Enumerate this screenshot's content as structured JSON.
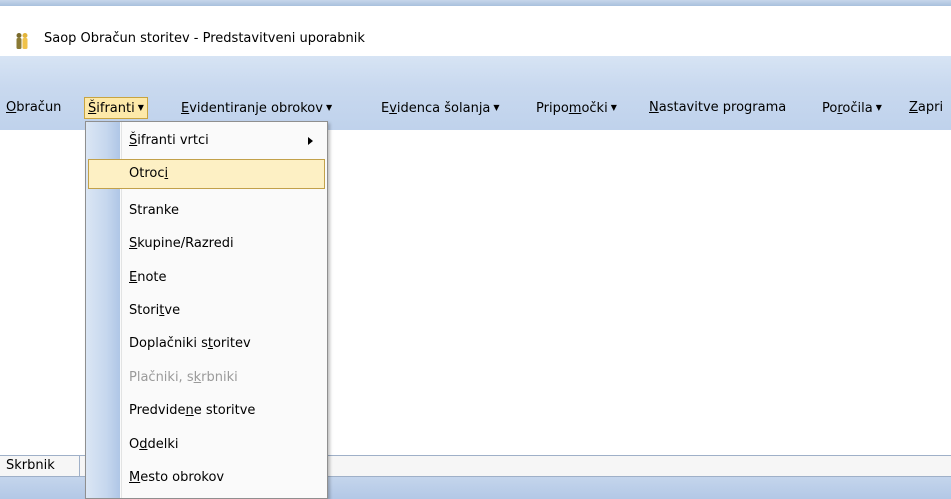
{
  "window": {
    "title": "Saop Obračun storitev - Predstavitveni uporabnik",
    "icon": "app-people-icon"
  },
  "menubar": {
    "items": [
      {
        "pre": "",
        "mn": "O",
        "post": "bračun",
        "dropdown": false
      },
      {
        "pre": "",
        "mn": "Š",
        "post": "ifranti",
        "dropdown": true
      },
      {
        "pre": "",
        "mn": "E",
        "post": "videntiranje obrokov",
        "dropdown": true
      },
      {
        "pre": "E",
        "mn": "v",
        "post": "idenca šolanja",
        "dropdown": true
      },
      {
        "pre": "Pripo",
        "mn": "m",
        "post": "očki",
        "dropdown": true
      },
      {
        "pre": "",
        "mn": "N",
        "post": "astavitve programa",
        "dropdown": false
      },
      {
        "pre": "Po",
        "mn": "r",
        "post": "očila",
        "dropdown": true
      },
      {
        "pre": "",
        "mn": "Z",
        "post": "apri",
        "dropdown": false
      }
    ]
  },
  "sifranti_menu": {
    "items": [
      {
        "pre": "",
        "mn": "Š",
        "post": "ifranti vrtci",
        "submenu": true,
        "enabled": true,
        "highlighted": false
      },
      {
        "pre": "Otroc",
        "mn": "i",
        "post": "",
        "submenu": false,
        "enabled": true,
        "highlighted": true
      },
      {
        "pre": "Stranke",
        "mn": "",
        "post": "",
        "submenu": false,
        "enabled": true,
        "highlighted": false
      },
      {
        "pre": "",
        "mn": "S",
        "post": "kupine/Razredi",
        "submenu": false,
        "enabled": true,
        "highlighted": false
      },
      {
        "pre": "",
        "mn": "E",
        "post": "note",
        "submenu": false,
        "enabled": true,
        "highlighted": false
      },
      {
        "pre": "Stori",
        "mn": "t",
        "post": "ve",
        "submenu": false,
        "enabled": true,
        "highlighted": false
      },
      {
        "pre": "Doplačniki s",
        "mn": "t",
        "post": "oritev",
        "submenu": false,
        "enabled": true,
        "highlighted": false
      },
      {
        "pre": "Plačniki, s",
        "mn": "k",
        "post": "rbniki",
        "submenu": false,
        "enabled": false,
        "highlighted": false
      },
      {
        "pre": "Predvide",
        "mn": "n",
        "post": "e storitve",
        "submenu": false,
        "enabled": true,
        "highlighted": false
      },
      {
        "pre": "O",
        "mn": "d",
        "post": "delki",
        "submenu": false,
        "enabled": true,
        "highlighted": false
      },
      {
        "pre": "",
        "mn": "M",
        "post": "esto obrokov",
        "submenu": false,
        "enabled": true,
        "highlighted": false
      }
    ]
  },
  "statusbar": {
    "left": "Skrbnik"
  },
  "colors": {
    "ribbon": "#c9d9ef",
    "highlight_fill": "#fdf0c4",
    "highlight_border": "#c2a14a",
    "disabled_text": "#9a9a9a"
  }
}
